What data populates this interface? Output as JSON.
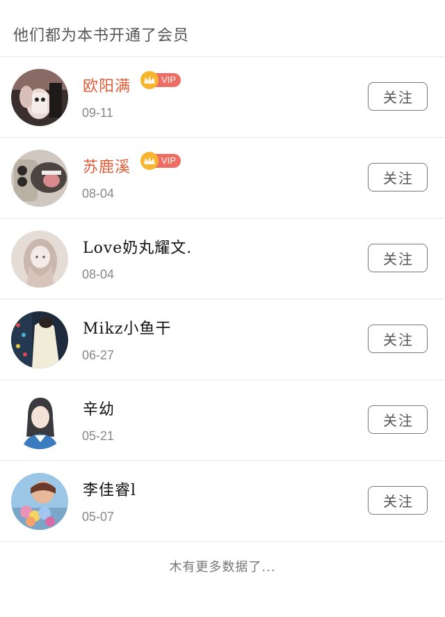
{
  "header": {
    "title": "他们都为本书开通了会员"
  },
  "members": [
    {
      "name": "欧阳满",
      "date": "09-11",
      "vip": true,
      "vip_label": "VIP",
      "follow_label": "关注"
    },
    {
      "name": "苏鹿溪",
      "date": "08-04",
      "vip": true,
      "vip_label": "VIP",
      "follow_label": "关注"
    },
    {
      "name": "Love奶丸耀文.",
      "date": "08-04",
      "vip": false,
      "follow_label": "关注"
    },
    {
      "name": "Mikz小鱼干",
      "date": "06-27",
      "vip": false,
      "follow_label": "关注"
    },
    {
      "name": "辛幼",
      "date": "05-21",
      "vip": false,
      "follow_label": "关注"
    },
    {
      "name": "李佳睿l",
      "date": "05-07",
      "vip": false,
      "follow_label": "关注"
    }
  ],
  "footer": {
    "text": "木有更多数据了..."
  },
  "colors": {
    "vip_name": "#e15b38",
    "vip_badge": "#ee6d62",
    "crown": "#f6b530",
    "divider": "#e6e6e6"
  }
}
